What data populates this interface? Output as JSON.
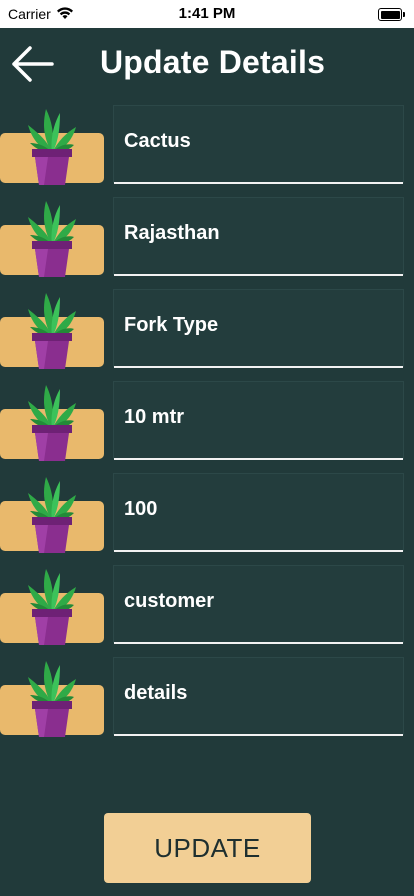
{
  "status_bar": {
    "carrier": "Carrier",
    "time": "1:41 PM"
  },
  "header": {
    "title": "Update Details"
  },
  "fields": [
    {
      "value": "Cactus"
    },
    {
      "value": "Rajasthan"
    },
    {
      "value": "Fork Type"
    },
    {
      "value": "10 mtr"
    },
    {
      "value": "100"
    },
    {
      "value": "customer"
    },
    {
      "value": "details"
    }
  ],
  "update_button": {
    "label": "UPDATE"
  },
  "icons": {
    "back": "arrow-left-icon",
    "plant": "potted-plant-icon"
  },
  "colors": {
    "background": "#213a3a",
    "button": "#f2cf95",
    "plant_base": "#e9b96c",
    "pot": "#8a2e8f",
    "leaf": "#2faa47"
  }
}
